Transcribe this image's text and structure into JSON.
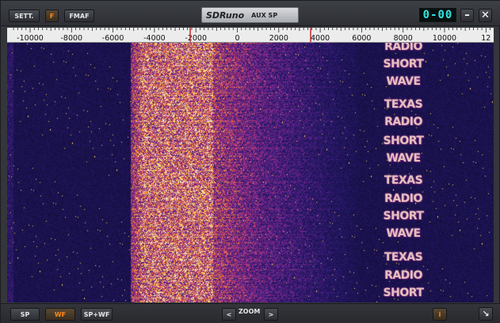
{
  "toolbar": {
    "sett_label": "SETT.",
    "f_label": "F",
    "fmaf_label": "FMAF"
  },
  "title": {
    "app_name": "SDRuno",
    "panel_name": "AUX SP"
  },
  "display": {
    "readout": "0-00"
  },
  "window": {
    "minimize_glyph": "–",
    "close_glyph": "✕"
  },
  "scale": {
    "tick_labels": [
      "-10000",
      "-8000",
      "-6000",
      "-4000",
      "-2000",
      "0",
      "2000",
      "4000",
      "6000",
      "8000",
      "10000",
      "12"
    ]
  },
  "waterfall": {
    "text_lines": [
      "RADIO",
      "SHORT",
      "WAVE",
      "TEXAS",
      "RADIO",
      "SHORT",
      "WAVE",
      "TEXAS",
      "RADIO",
      "SHORT",
      "WAVE",
      "TEXAS",
      "RADIO",
      "SHORT"
    ]
  },
  "bottom": {
    "sp_label": "SP",
    "wf_label": "WF",
    "spwf_label": "SP+WF",
    "zoom_out": "<",
    "zoom_label": "ZOOM",
    "zoom_in": ">",
    "info_label": "i",
    "resize_glyph": "↘"
  },
  "colors": {
    "accent_orange": "#ff8a1a",
    "readout_cyan": "#33e4e0",
    "marker_red": "#c0282d"
  }
}
